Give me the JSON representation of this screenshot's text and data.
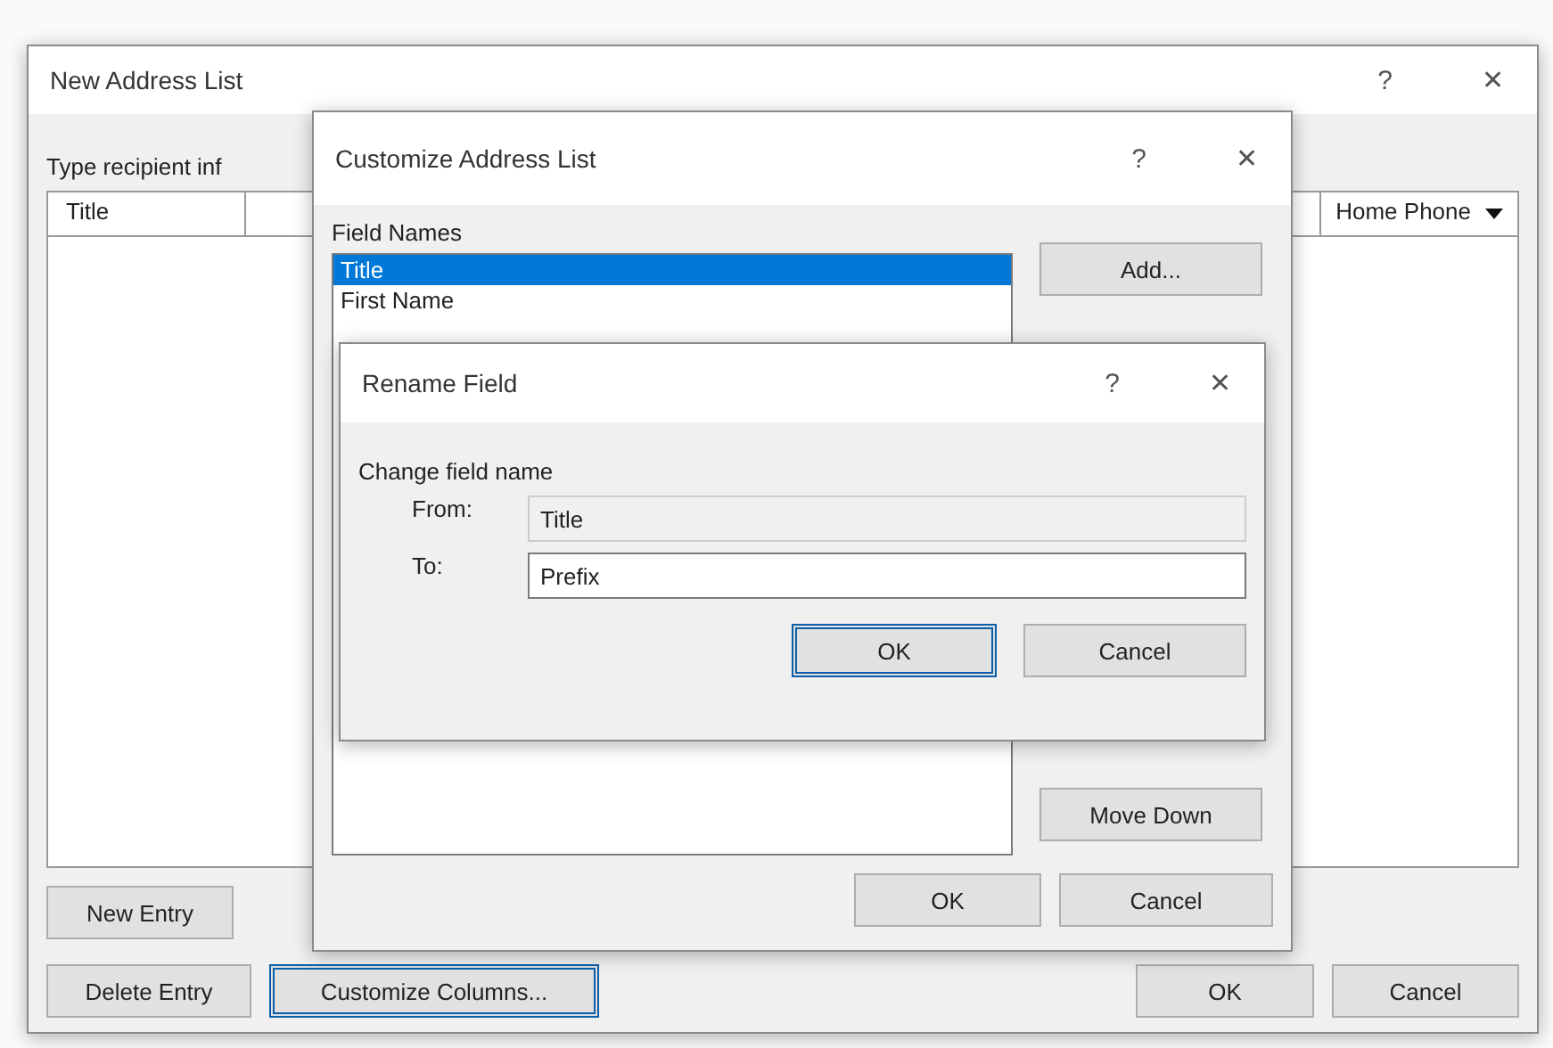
{
  "address_list": {
    "title": "New Address List",
    "instruction": "Type recipient inf",
    "columns": [
      {
        "label": "Title"
      },
      {
        "label": "Home Phone"
      }
    ],
    "buttons": {
      "new_entry": "New Entry",
      "delete_entry": "Delete Entry",
      "customize": "Customize Columns...",
      "ok": "OK",
      "cancel": "Cancel"
    },
    "help": "?",
    "close": "✕"
  },
  "customize": {
    "title": "Customize Address List",
    "field_names_label": "Field Names",
    "fields": [
      {
        "label": "Title",
        "selected": true
      },
      {
        "label": "First Name",
        "selected": false
      }
    ],
    "side_buttons": [
      "Add...",
      "Move Down"
    ],
    "ok": "OK",
    "cancel": "Cancel",
    "help": "?",
    "close": "✕"
  },
  "rename": {
    "title": "Rename Field",
    "prompt": "Change field name",
    "from_label": "From:",
    "from_value": "Title",
    "to_label": "To:",
    "to_value": "Prefix",
    "ok": "OK",
    "cancel": "Cancel",
    "help": "?",
    "close": "✕"
  }
}
